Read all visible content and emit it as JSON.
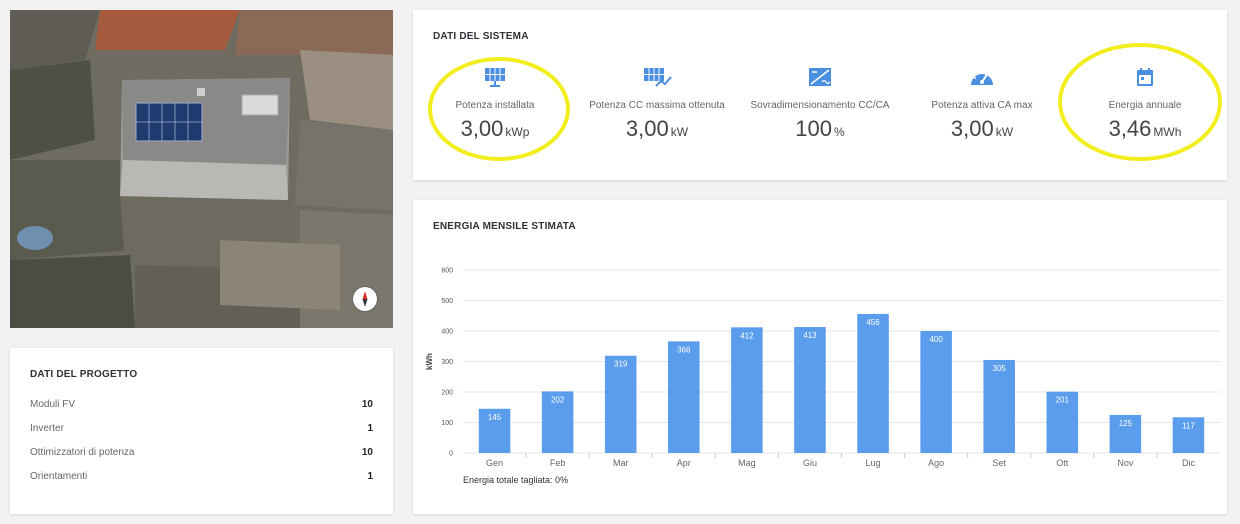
{
  "map": {
    "compass_icon": "compass-icon"
  },
  "project": {
    "title": "DATI DEL PROGETTO",
    "rows": [
      {
        "label": "Moduli FV",
        "value": "10"
      },
      {
        "label": "Inverter",
        "value": "1"
      },
      {
        "label": "Ottimizzatori di potenza",
        "value": "10"
      },
      {
        "label": "Orientamenti",
        "value": "1"
      }
    ]
  },
  "system": {
    "title": "DATI DEL SISTEMA",
    "metrics": [
      {
        "icon": "solar-panel-icon",
        "label": "Potenza installata",
        "value": "3,00",
        "unit": "kWp",
        "highlighted": true
      },
      {
        "icon": "solar-panel-chart-icon",
        "label": "Potenza CC massima ottenuta",
        "value": "3,00",
        "unit": "kW",
        "highlighted": false
      },
      {
        "icon": "dc-ac-ratio-icon",
        "label": "Sovradimensionamento CC/CA",
        "value": "100",
        "unit": "%",
        "highlighted": false
      },
      {
        "icon": "speedometer-icon",
        "label": "Potenza attiva CA max",
        "value": "3,00",
        "unit": "kW",
        "highlighted": false
      },
      {
        "icon": "calendar-icon",
        "label": "Energia annuale",
        "value": "3,46",
        "unit": "MWh",
        "highlighted": true
      }
    ],
    "highlight_color": "#f2ee1e"
  },
  "chart": {
    "title": "ENERGIA MENSILE STIMATA",
    "footnote": "Energia totale tagliata: 0%"
  },
  "chart_data": {
    "type": "bar",
    "categories": [
      "Gen",
      "Feb",
      "Mar",
      "Apr",
      "Mag",
      "Giu",
      "Lug",
      "Ago",
      "Set",
      "Ott",
      "Nov",
      "Dic"
    ],
    "values": [
      145,
      202,
      319,
      366,
      412,
      413,
      456,
      400,
      305,
      201,
      125,
      117
    ],
    "ylabel": "kWh",
    "ylim": [
      0,
      600
    ],
    "yticks": [
      0,
      100,
      200,
      300,
      400,
      500,
      600
    ],
    "grid": true,
    "bar_color": "#5a9ded",
    "data_labels": true
  }
}
